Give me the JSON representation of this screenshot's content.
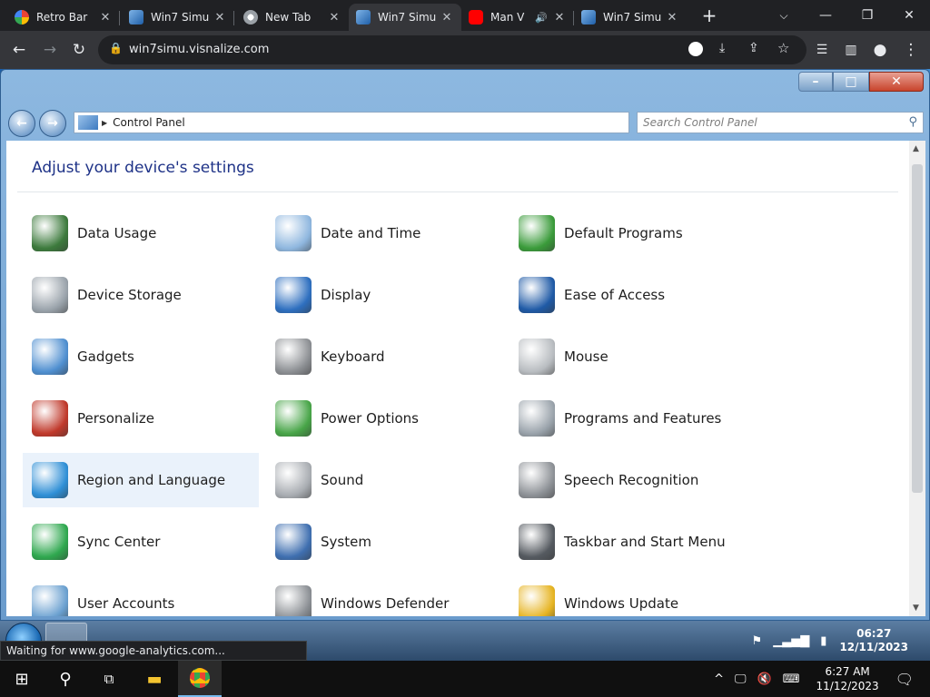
{
  "browser": {
    "tabs": [
      {
        "label": "Retro Bar",
        "favicon": "google-favicon",
        "active": false
      },
      {
        "label": "Win7 Simu",
        "favicon": "win7-favicon",
        "active": false
      },
      {
        "label": "New Tab",
        "favicon": "chrome-favicon",
        "active": false
      },
      {
        "label": "Win7 Simu",
        "favicon": "win7-favicon",
        "active": true
      },
      {
        "label": "Man V",
        "favicon": "youtube-favicon",
        "active": false
      },
      {
        "label": "Win7 Simu",
        "favicon": "win7-favicon",
        "active": false
      }
    ],
    "new_tab_label": "+",
    "url": "win7simu.visnalize.com"
  },
  "control_panel": {
    "breadcrumb": "Control Panel",
    "search_placeholder": "Search Control Panel",
    "heading": "Adjust your device's settings",
    "items": [
      {
        "label": "Data Usage",
        "icon": "data-usage-icon",
        "color": "#3c7a3c"
      },
      {
        "label": "Date and Time",
        "icon": "date-time-icon",
        "color": "#8fb7df"
      },
      {
        "label": "Default Programs",
        "icon": "default-programs-icon",
        "color": "#3a9b3a"
      },
      {
        "label": "Device Storage",
        "icon": "device-storage-icon",
        "color": "#9aa3ab"
      },
      {
        "label": "Display",
        "icon": "display-icon",
        "color": "#2e6fbf"
      },
      {
        "label": "Ease of Access",
        "icon": "ease-of-access-icon",
        "color": "#1f5aa6"
      },
      {
        "label": "Gadgets",
        "icon": "gadgets-icon",
        "color": "#4f8fd0"
      },
      {
        "label": "Keyboard",
        "icon": "keyboard-icon",
        "color": "#8c8f93"
      },
      {
        "label": "Mouse",
        "icon": "mouse-icon",
        "color": "#b8bcc0"
      },
      {
        "label": "Personalize",
        "icon": "personalize-icon",
        "color": "#c0392b"
      },
      {
        "label": "Power Options",
        "icon": "power-options-icon",
        "color": "#48a548"
      },
      {
        "label": "Programs and Features",
        "icon": "programs-features-icon",
        "color": "#9aa3ab"
      },
      {
        "label": "Region and Language",
        "icon": "region-language-icon",
        "color": "#2f8fd6"
      },
      {
        "label": "Sound",
        "icon": "sound-icon",
        "color": "#a9adb2"
      },
      {
        "label": "Speech Recognition",
        "icon": "speech-recognition-icon",
        "color": "#8d9196"
      },
      {
        "label": "Sync Center",
        "icon": "sync-center-icon",
        "color": "#2fa84f"
      },
      {
        "label": "System",
        "icon": "system-icon",
        "color": "#3f6fb0"
      },
      {
        "label": "Taskbar and Start Menu",
        "icon": "taskbar-start-icon",
        "color": "#555a60"
      },
      {
        "label": "User Accounts",
        "icon": "user-accounts-icon",
        "color": "#6aa0d0"
      },
      {
        "label": "Windows Defender",
        "icon": "windows-defender-icon",
        "color": "#8b8f94"
      },
      {
        "label": "Windows Update",
        "icon": "windows-update-icon",
        "color": "#e6b422"
      }
    ]
  },
  "win7_taskbar": {
    "time": "06:27",
    "date": "12/11/2023"
  },
  "status_bubble": "Waiting for www.google-analytics.com...",
  "win10_taskbar": {
    "time": "6:27 AM",
    "date": "11/12/2023"
  }
}
